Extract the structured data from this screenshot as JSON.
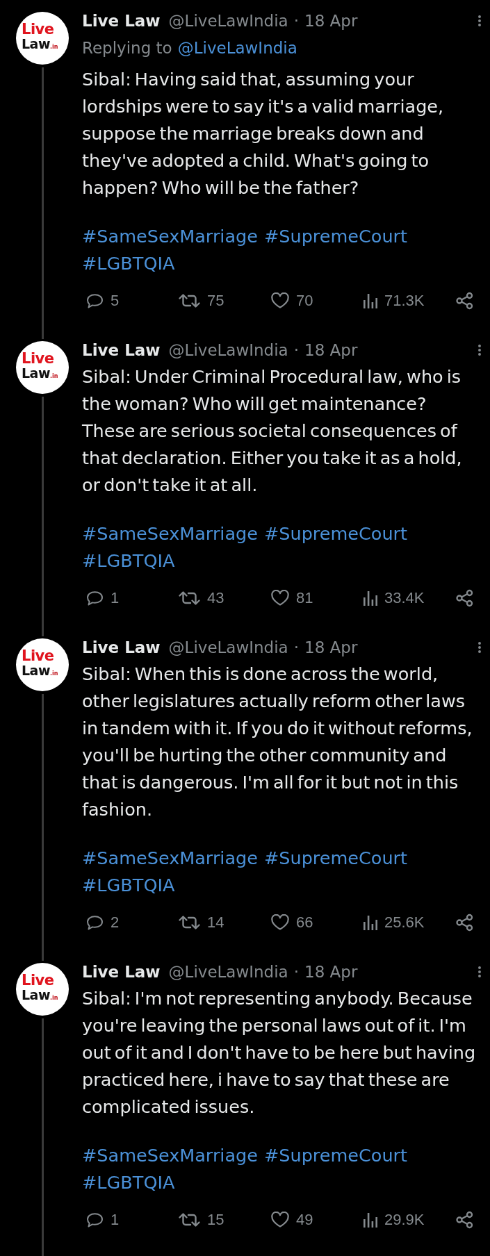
{
  "posts": [
    {
      "avatar": {
        "logo_top": "Live",
        "logo_bottom": "Law",
        "logo_suffix": ".in"
      },
      "author": {
        "name": "Live Law",
        "handle": "@LiveLawIndia"
      },
      "separator": "·",
      "date": "18 Apr",
      "reply_to": {
        "label": "Replying to",
        "mention": "@LiveLawIndia"
      },
      "text": "Sibal: Having said that, assuming your lordships were to say it's a valid marriage, suppose the marriage breaks down and they've adopted a child. What's going to happen? Who will be the father?",
      "hashtags": [
        "#SameSexMarriage",
        "#SupremeCourt",
        "#LGBTQIA"
      ],
      "actions": [
        {
          "kind": "reply",
          "count": "5"
        },
        {
          "kind": "repost",
          "count": "75"
        },
        {
          "kind": "like",
          "count": "70"
        },
        {
          "kind": "views",
          "count": "71.3K"
        },
        {
          "kind": "share"
        }
      ]
    },
    {
      "avatar": {
        "logo_top": "Live",
        "logo_bottom": "Law",
        "logo_suffix": ".in"
      },
      "author": {
        "name": "Live Law",
        "handle": "@LiveLawIndia"
      },
      "separator": "·",
      "date": "18 Apr",
      "text": "Sibal: Under Criminal Procedural law, who is the woman? Who will get maintenance? These are serious societal consequences of that declaration. Either you take it as a hold, or don't take it at all.",
      "hashtags": [
        "#SameSexMarriage",
        "#SupremeCourt",
        "#LGBTQIA"
      ],
      "actions": [
        {
          "kind": "reply",
          "count": "1"
        },
        {
          "kind": "repost",
          "count": "43"
        },
        {
          "kind": "like",
          "count": "81"
        },
        {
          "kind": "views",
          "count": "33.4K"
        },
        {
          "kind": "share"
        }
      ]
    },
    {
      "avatar": {
        "logo_top": "Live",
        "logo_bottom": "Law",
        "logo_suffix": ".in"
      },
      "author": {
        "name": "Live Law",
        "handle": "@LiveLawIndia"
      },
      "separator": "·",
      "date": "18 Apr",
      "text": "Sibal: When this is done across the world, other legislatures actually reform other laws in tandem with it. If you do it without reforms, you'll be hurting the other community and that is dangerous. I'm all for it but not in this fashion.",
      "hashtags": [
        "#SameSexMarriage",
        "#SupremeCourt",
        "#LGBTQIA"
      ],
      "actions": [
        {
          "kind": "reply",
          "count": "2"
        },
        {
          "kind": "repost",
          "count": "14"
        },
        {
          "kind": "like",
          "count": "66"
        },
        {
          "kind": "views",
          "count": "25.6K"
        },
        {
          "kind": "share"
        }
      ]
    },
    {
      "avatar": {
        "logo_top": "Live",
        "logo_bottom": "Law",
        "logo_suffix": ".in"
      },
      "author": {
        "name": "Live Law",
        "handle": "@LiveLawIndia"
      },
      "separator": "·",
      "date": "18 Apr",
      "text": "Sibal: I'm not representing anybody. Because you're leaving the personal laws out of it. I'm out of it and I don't have to be here but having practiced here, i have to say that these are complicated issues.",
      "hashtags": [
        "#SameSexMarriage",
        "#SupremeCourt",
        "#LGBTQIA"
      ],
      "actions": [
        {
          "kind": "reply",
          "count": "1"
        },
        {
          "kind": "repost",
          "count": "15"
        },
        {
          "kind": "like",
          "count": "49"
        },
        {
          "kind": "views",
          "count": "29.9K"
        },
        {
          "kind": "share"
        }
      ]
    }
  ]
}
